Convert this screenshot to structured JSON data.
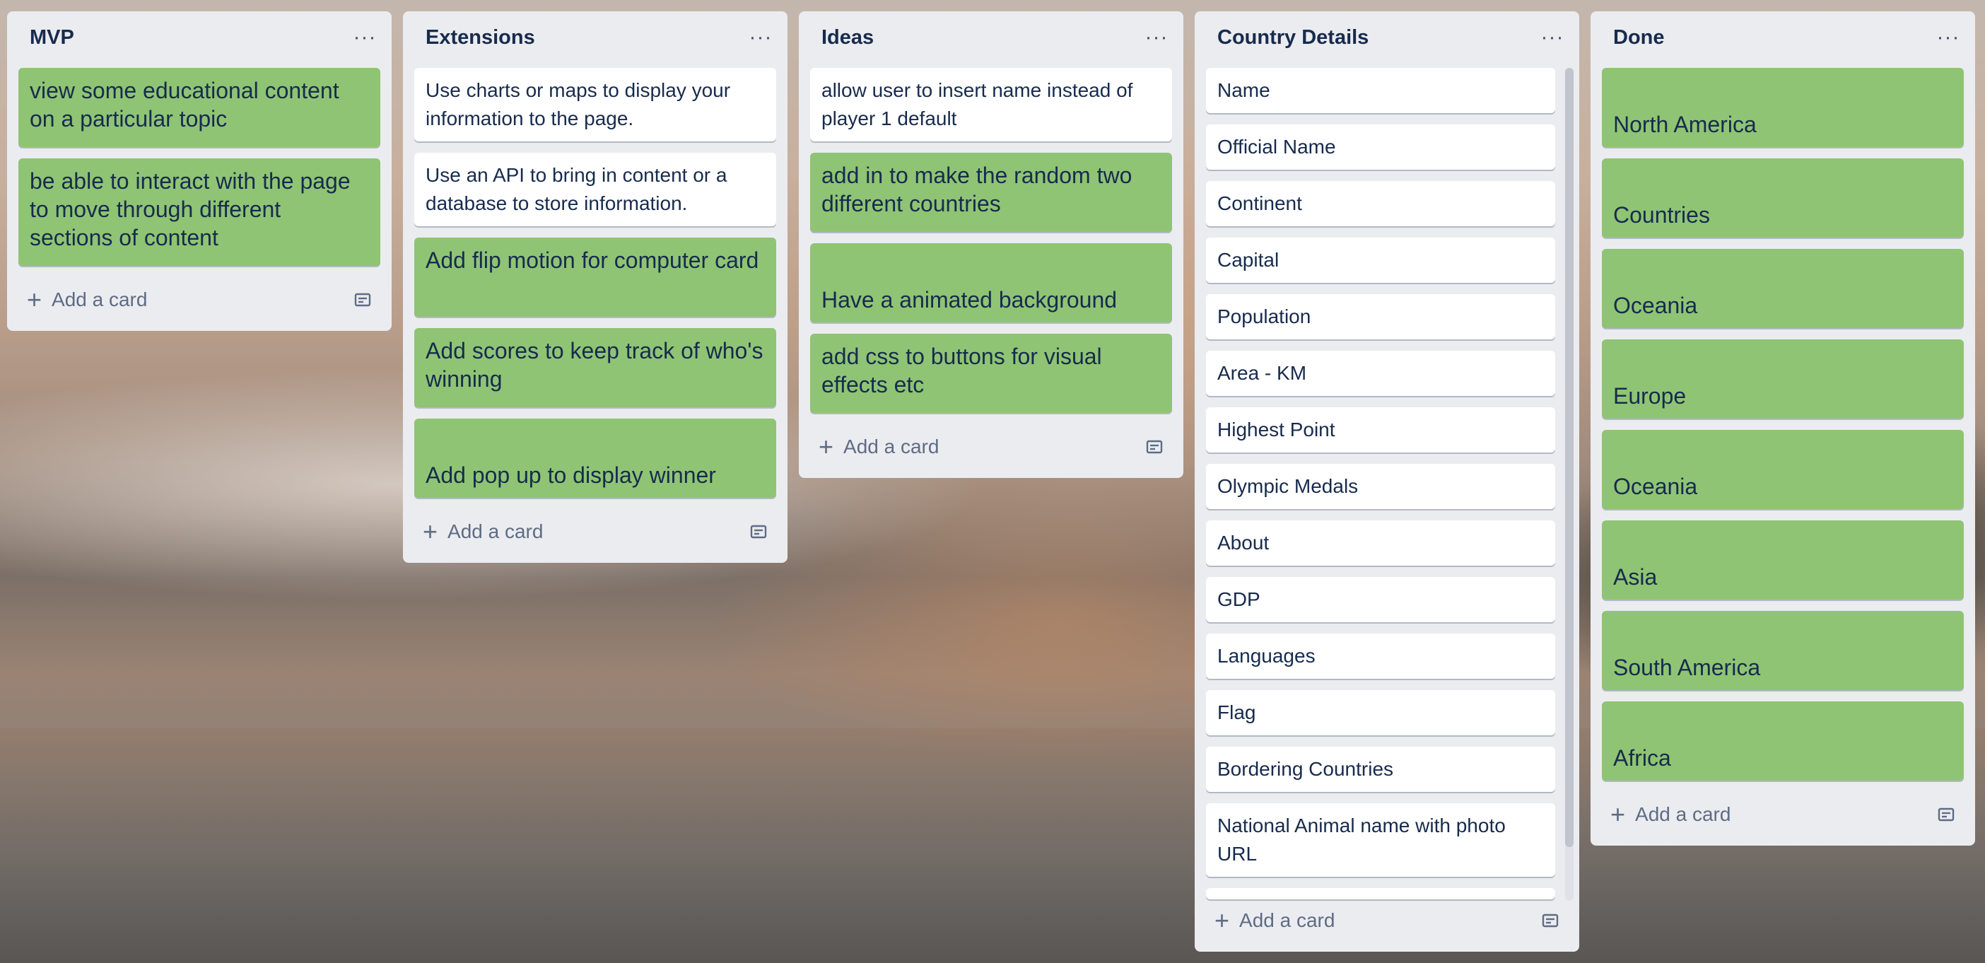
{
  "lists": [
    {
      "title": "MVP",
      "cards": [
        {
          "text": "view some educational content on a particular topic"
        },
        {
          "text": "be able to interact with the page to move through different sections of content"
        }
      ],
      "add_label": "Add a card"
    },
    {
      "title": "Extensions",
      "cards": [
        {
          "text": "Use charts or maps to display your information to the page."
        },
        {
          "text": "Use an API to bring in content or a database to store information."
        },
        {
          "text": "Add flip motion for computer card"
        },
        {
          "text": "Add scores to keep track of who's winning"
        },
        {
          "text": "Add pop up to display winner"
        }
      ],
      "add_label": "Add a card"
    },
    {
      "title": "Ideas",
      "cards": [
        {
          "text": "allow user to insert name instead of player 1 default"
        },
        {
          "text": "add in to make the random two different countries"
        },
        {
          "text": "Have a animated background"
        },
        {
          "text": "add css to buttons for visual effects etc"
        }
      ],
      "add_label": "Add a card"
    },
    {
      "title": "Country Details",
      "cards": [
        {
          "text": "Name"
        },
        {
          "text": "Official Name"
        },
        {
          "text": "Continent"
        },
        {
          "text": "Capital"
        },
        {
          "text": "Population"
        },
        {
          "text": "Area - KM"
        },
        {
          "text": "Highest Point"
        },
        {
          "text": "Olympic Medals"
        },
        {
          "text": "About"
        },
        {
          "text": "GDP"
        },
        {
          "text": "Languages"
        },
        {
          "text": "Flag"
        },
        {
          "text": "Bordering Countries"
        },
        {
          "text": "National Animal name with photo URL"
        }
      ],
      "add_label": "Add a card"
    },
    {
      "title": "Done",
      "cards": [
        {
          "text": "North America"
        },
        {
          "text": "Countries"
        },
        {
          "text": "Oceania"
        },
        {
          "text": "Europe"
        },
        {
          "text": "Oceania"
        },
        {
          "text": "Asia"
        },
        {
          "text": "South America"
        },
        {
          "text": "Africa"
        }
      ],
      "add_label": "Add a card"
    }
  ],
  "menu_glyph": "···",
  "add_glyph": "+",
  "colors": {
    "list_bg": "#ebecf0",
    "card_white": "#ffffff",
    "card_green": "#8fc474",
    "text_dark": "#172b4d",
    "text_muted": "#5e6c84"
  },
  "icons": {
    "menu": "more-horizontal-icon",
    "add": "plus-icon",
    "template": "card-template-icon"
  }
}
